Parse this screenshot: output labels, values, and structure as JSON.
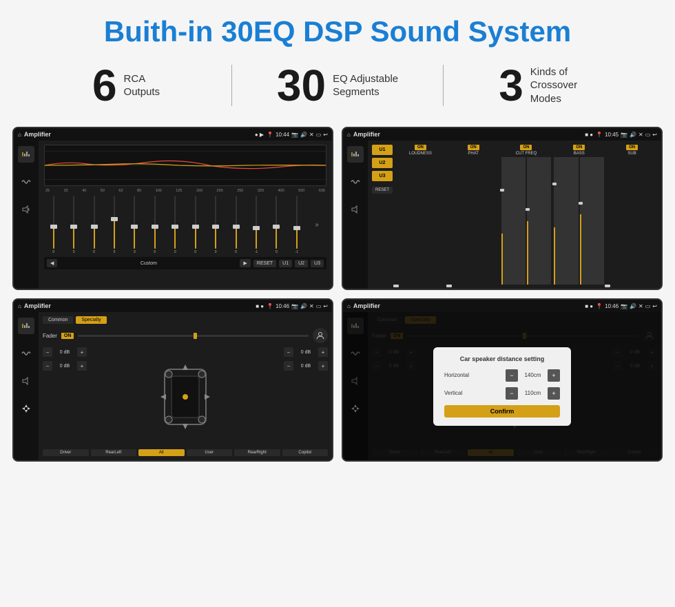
{
  "page": {
    "title": "Buith-in 30EQ DSP Sound System",
    "stats": [
      {
        "number": "6",
        "text_line1": "RCA",
        "text_line2": "Outputs"
      },
      {
        "number": "30",
        "text_line1": "EQ Adjustable",
        "text_line2": "Segments"
      },
      {
        "number": "3",
        "text_line1": "Kinds of",
        "text_line2": "Crossover Modes"
      }
    ]
  },
  "screen1": {
    "app_name": "Amplifier",
    "time": "10:44",
    "eq_freqs": [
      "25",
      "32",
      "40",
      "50",
      "63",
      "80",
      "100",
      "125",
      "160",
      "200",
      "250",
      "320",
      "400",
      "500",
      "630"
    ],
    "eq_vals": [
      "0",
      "0",
      "0",
      "5",
      "0",
      "0",
      "0",
      "0",
      "0",
      "0",
      "-1",
      "0",
      "-1"
    ],
    "nav_items": [
      "Custom",
      "RESET",
      "U1",
      "U2",
      "U3"
    ]
  },
  "screen2": {
    "app_name": "Amplifier",
    "time": "10:45",
    "presets": [
      "U1",
      "U2",
      "U3"
    ],
    "cols": [
      "LOUDNESS",
      "PHAT",
      "CUT FREQ",
      "BASS",
      "SUB"
    ],
    "reset_label": "RESET"
  },
  "screen3": {
    "app_name": "Amplifier",
    "time": "10:46",
    "tabs": [
      "Common",
      "Specialty"
    ],
    "fader_label": "Fader",
    "on_label": "ON",
    "vol_rows": [
      {
        "label": "0 dB"
      },
      {
        "label": "0 dB"
      },
      {
        "label": "0 dB"
      },
      {
        "label": "0 dB"
      }
    ],
    "nav_btns": [
      "Driver",
      "RearLeft",
      "All",
      "User",
      "RearRight",
      "Copilot"
    ]
  },
  "screen4": {
    "app_name": "Amplifier",
    "time": "10:46",
    "tabs": [
      "Common",
      "Specialty"
    ],
    "on_label": "ON",
    "dialog": {
      "title": "Car speaker distance setting",
      "horizontal_label": "Horizontal",
      "horizontal_value": "140cm",
      "vertical_label": "Vertical",
      "vertical_value": "110cm",
      "confirm_label": "Confirm"
    },
    "vol_rows": [
      {
        "label": "0 dB"
      },
      {
        "label": "0 dB"
      }
    ],
    "nav_btns": [
      "Driver",
      "RearLeft",
      "All",
      "User",
      "RearRight",
      "Copilot"
    ]
  },
  "icons": {
    "home": "⌂",
    "pin": "📍",
    "camera": "📷",
    "volume": "🔊",
    "x_box": "✕",
    "rect": "▭",
    "back": "↩",
    "play": "▶",
    "prev": "◀",
    "next": "▶",
    "eq": "≡",
    "wave": "∿",
    "speaker": "🔈",
    "arrow_up": "▲",
    "arrow_down": "▼",
    "arrow_left": "◄",
    "arrow_right": "►",
    "plus": "+",
    "minus": "−",
    "person": "👤"
  }
}
